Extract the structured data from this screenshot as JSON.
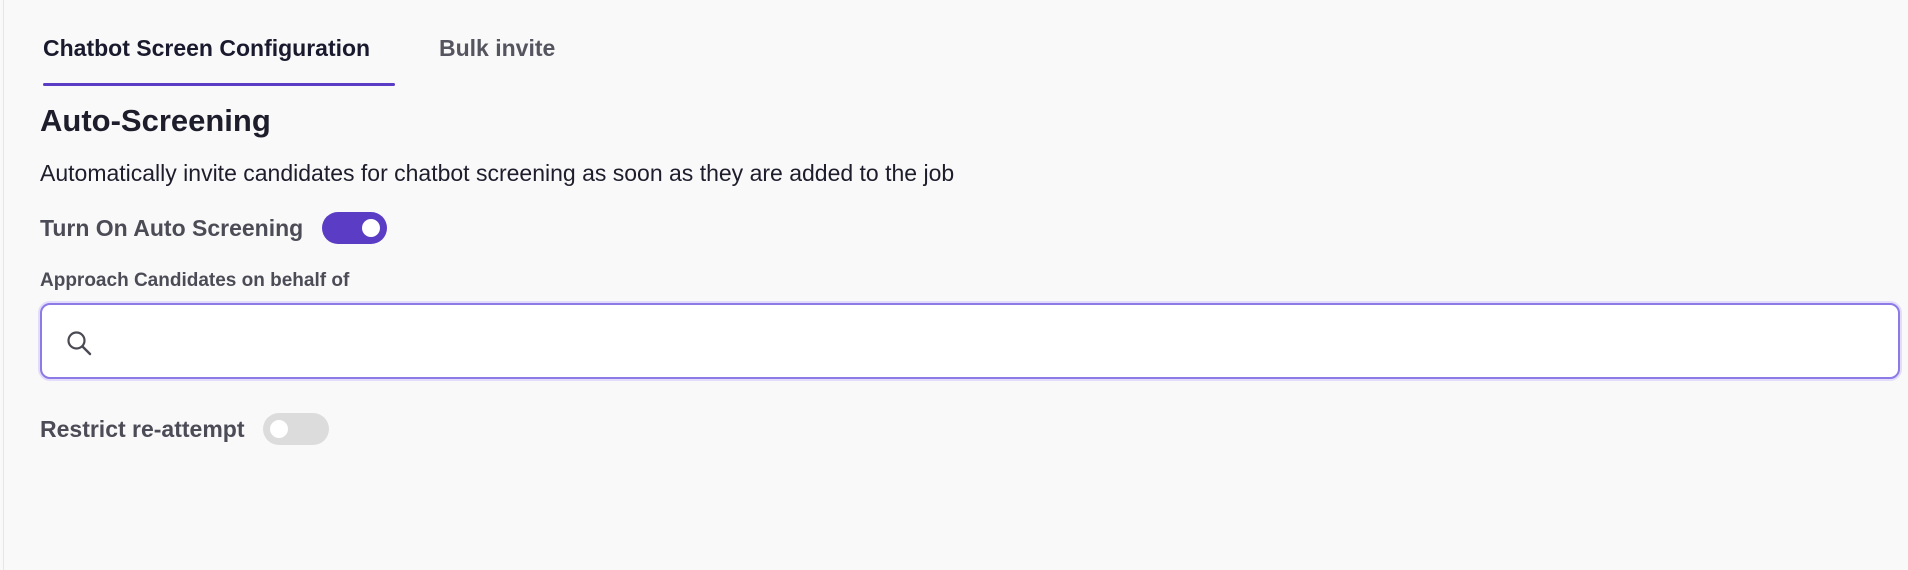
{
  "tabs": [
    {
      "label": "Chatbot Screen Configuration",
      "active": true
    },
    {
      "label": "Bulk invite",
      "active": false
    }
  ],
  "section": {
    "title": "Auto-Screening",
    "description": "Automatically invite candidates for chatbot screening as soon as they are added to the job"
  },
  "auto_screening": {
    "label": "Turn On Auto Screening",
    "enabled": true
  },
  "approach": {
    "label": "Approach Candidates on behalf of",
    "value": "",
    "icon": "search-icon"
  },
  "restrict": {
    "label": "Restrict re-attempt",
    "enabled": false
  },
  "colors": {
    "accent": "#5b3cc4",
    "toggle_off": "#dcdcdc",
    "focus_border": "#8c7ae6"
  }
}
